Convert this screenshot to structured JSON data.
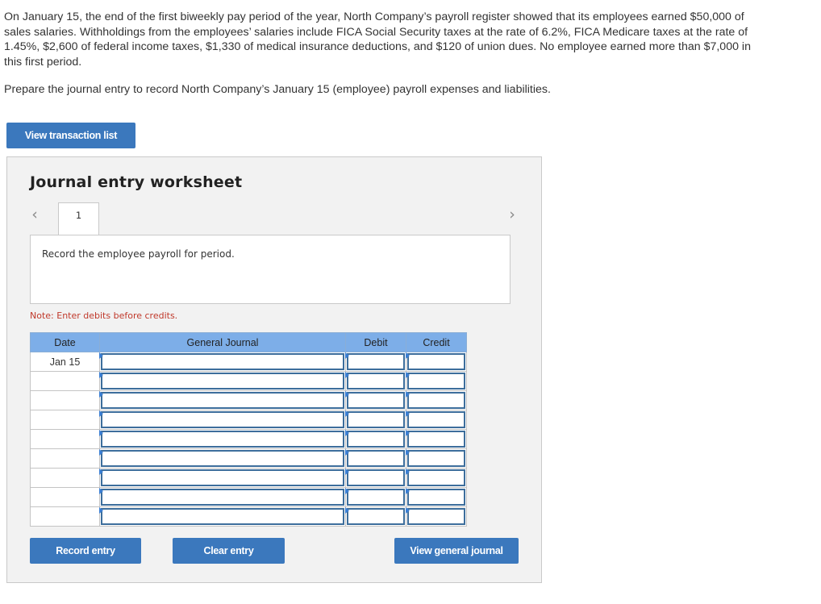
{
  "problem": {
    "paragraph": "On January 15, the end of the first biweekly pay period of the year, North Company’s payroll register showed that its employees earned $50,000 of sales salaries. Withholdings from the employees’ salaries include FICA Social Security taxes at the rate of 6.2%, FICA Medicare taxes at the rate of 1.45%, $2,600 of federal income taxes, $1,330 of medical insurance deductions, and $120 of union dues. No employee earned more than $7,000 in this first period.",
    "instruction": "Prepare the journal entry to record North Company’s January 15 (employee) payroll expenses and liabilities."
  },
  "buttons": {
    "view_transaction_list": "View transaction list",
    "record_entry": "Record entry",
    "clear_entry": "Clear entry",
    "view_general_journal": "View general journal"
  },
  "worksheet": {
    "title": "Journal entry worksheet",
    "prev_icon": "‹",
    "next_icon": "›",
    "active_tab": "1",
    "description": "Record the employee payroll for period.",
    "note": "Note: Enter debits before credits."
  },
  "journal": {
    "headers": {
      "date": "Date",
      "general_journal": "General Journal",
      "debit": "Debit",
      "credit": "Credit"
    },
    "rows": [
      {
        "date": "Jan 15",
        "account": "",
        "debit": "",
        "credit": ""
      },
      {
        "date": "",
        "account": "",
        "debit": "",
        "credit": ""
      },
      {
        "date": "",
        "account": "",
        "debit": "",
        "credit": ""
      },
      {
        "date": "",
        "account": "",
        "debit": "",
        "credit": ""
      },
      {
        "date": "",
        "account": "",
        "debit": "",
        "credit": ""
      },
      {
        "date": "",
        "account": "",
        "debit": "",
        "credit": ""
      },
      {
        "date": "",
        "account": "",
        "debit": "",
        "credit": ""
      },
      {
        "date": "",
        "account": "",
        "debit": "",
        "credit": ""
      },
      {
        "date": "",
        "account": "",
        "debit": "",
        "credit": ""
      }
    ]
  },
  "colors": {
    "button_blue": "#3b78bd",
    "header_blue": "#7daee8",
    "field_border": "#3d6e9c",
    "note_red": "#c0392b",
    "panel_bg": "#f2f2f2"
  }
}
